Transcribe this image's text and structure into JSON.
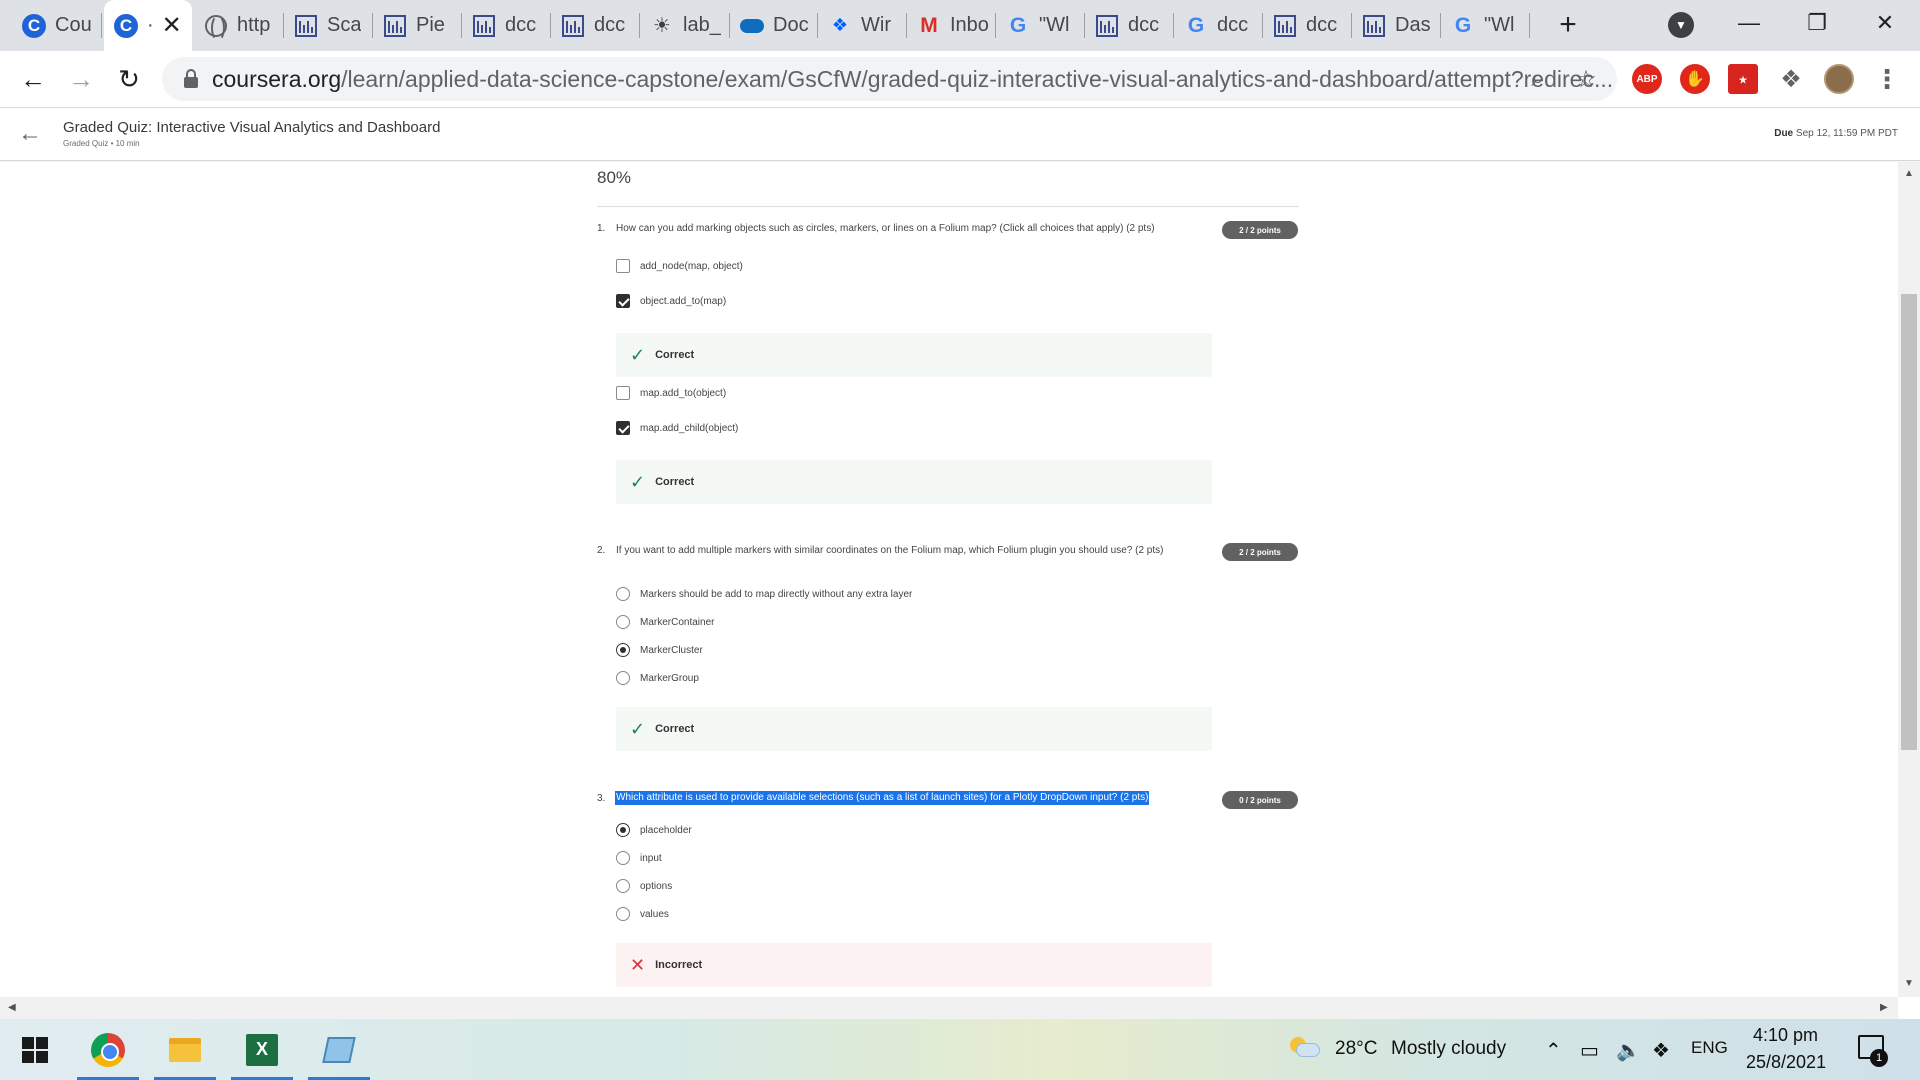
{
  "browser": {
    "tabs": [
      {
        "title": "Cou",
        "icon": "coursera-icon",
        "active": false
      },
      {
        "title": "·",
        "icon": "coursera-icon",
        "active": true
      },
      {
        "title": "http",
        "icon": "globe-icon",
        "active": false
      },
      {
        "title": "Sca",
        "icon": "bars-icon",
        "active": false
      },
      {
        "title": "Pie",
        "icon": "bars-icon",
        "active": false
      },
      {
        "title": "dcc",
        "icon": "bars-icon",
        "active": false
      },
      {
        "title": "dcc",
        "icon": "bars-icon",
        "active": false
      },
      {
        "title": "lab_",
        "icon": "bulb-icon",
        "active": false
      },
      {
        "title": "Doc",
        "icon": "onedrive-icon",
        "active": false
      },
      {
        "title": "Wir",
        "icon": "dropbox-icon",
        "active": false
      },
      {
        "title": "Inbo",
        "icon": "gmail-icon",
        "active": false
      },
      {
        "title": "\"Wl",
        "icon": "google-icon",
        "active": false
      },
      {
        "title": "dcc",
        "icon": "bars-icon",
        "active": false
      },
      {
        "title": "dcc",
        "icon": "google-icon",
        "active": false
      },
      {
        "title": "dcc",
        "icon": "bars-icon",
        "active": false
      },
      {
        "title": "Das",
        "icon": "bars-icon",
        "active": false
      },
      {
        "title": "\"Wl",
        "icon": "google-icon",
        "active": false
      }
    ],
    "url_host": "coursera.org",
    "url_path": "/learn/applied-data-science-capstone/exam/GsCfW/graded-quiz-interactive-visual-analytics-and-dashboard/attempt?redirec...",
    "extensions": {
      "abp": "ABP",
      "pdf": "⭑"
    }
  },
  "header": {
    "title": "Graded Quiz: Interactive Visual Analytics and Dashboard",
    "subtitle": "Graded Quiz • 10 min",
    "due_label": "Due",
    "due_value": "Sep 12, 11:59 PM PDT"
  },
  "score": "80%",
  "questions": [
    {
      "num": "1.",
      "text": "How can you add marking objects such as circles, markers, or lines on a Folium map? (Click all choices that apply) (2 pts)",
      "points": "2 / 2 points",
      "options": [
        {
          "label": "add_node(map, object)",
          "checked": false
        },
        {
          "label": "object.add_to(map)",
          "checked": true
        },
        {
          "label": "map.add_to(object)",
          "checked": false
        },
        {
          "label": "map.add_child(object)",
          "checked": true
        }
      ],
      "feedback": [
        "Correct",
        "Correct"
      ]
    },
    {
      "num": "2.",
      "text": "If you want to add multiple markers with similar coordinates on the Folium map, which Folium plugin you should use? (2 pts)",
      "points": "2 / 2 points",
      "options": [
        {
          "label": "Markers should be add to map directly without any extra layer",
          "checked": false
        },
        {
          "label": "MarkerContainer",
          "checked": false
        },
        {
          "label": "MarkerCluster",
          "checked": true
        },
        {
          "label": "MarkerGroup",
          "checked": false
        }
      ],
      "feedback": [
        "Correct"
      ]
    },
    {
      "num": "3.",
      "text": "Which attribute is used to provide available selections (such as a list of launch sites) for a Plotly DropDown input? (2 pts)",
      "points": "0 / 2 points",
      "options": [
        {
          "label": "placeholder",
          "checked": true
        },
        {
          "label": "input",
          "checked": false
        },
        {
          "label": "options",
          "checked": false
        },
        {
          "label": "values",
          "checked": false
        }
      ],
      "feedback": [
        "Incorrect"
      ]
    }
  ],
  "taskbar": {
    "weather_temp": "28°C",
    "weather_text": "Mostly cloudy",
    "language": "ENG",
    "time": "4:10 pm",
    "date": "25/8/2021",
    "notification_count": "1"
  },
  "colors": {
    "accent": "#1a73e8",
    "correct": "#1f8354",
    "incorrect": "#d5343f",
    "badge": "#616161"
  }
}
